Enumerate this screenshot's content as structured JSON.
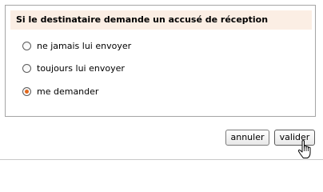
{
  "dialog": {
    "heading": "Si le destinataire demande un accusé de réception",
    "options": [
      {
        "label": "ne jamais lui envoyer",
        "checked": false
      },
      {
        "label": "toujours lui envoyer",
        "checked": false
      },
      {
        "label": "me demander",
        "checked": true
      }
    ]
  },
  "buttons": {
    "cancel_label": "annuler",
    "validate_label": "valider"
  },
  "cursor": {
    "icon": "hand-pointer-icon"
  },
  "colors": {
    "header_bg": "#fbeee4",
    "radio_selected": "#e2681d",
    "panel_border": "#a5a5a5"
  }
}
